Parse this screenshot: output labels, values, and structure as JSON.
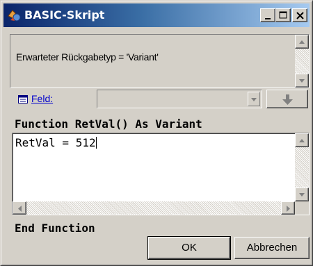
{
  "window": {
    "title": "BASIC-Skript"
  },
  "info": {
    "text": "Erwarteter Rückgabetyp = 'Variant'"
  },
  "field": {
    "label": "Feld:",
    "selected_value": ""
  },
  "code": {
    "header": "Function RetVal() As Variant",
    "body": "RetVal = 512",
    "footer": "End Function"
  },
  "buttons": {
    "ok": "OK",
    "cancel": "Abbrechen"
  },
  "icons": {
    "app": "script-app-icon",
    "field": "field-icon",
    "insert": "insert-down-arrow-icon"
  }
}
